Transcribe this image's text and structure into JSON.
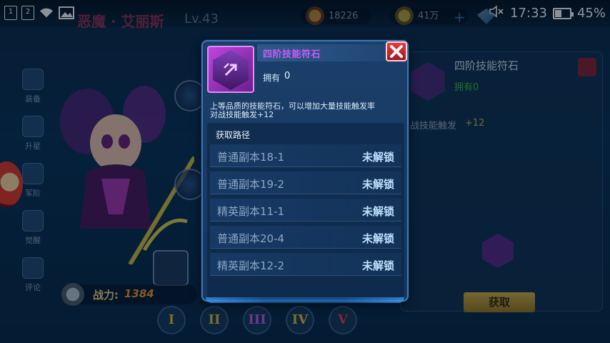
{
  "status_bar": {
    "notif_1": "1",
    "notif_2": "2",
    "time": "17:33",
    "battery": "45%",
    "battery_level": 0.45,
    "icons": [
      "sim-1-icon",
      "sim-2-icon",
      "wifi-icon",
      "image-icon",
      "mute-icon",
      "battery-icon"
    ]
  },
  "background": {
    "hero_name": "恶魔 · 艾丽斯",
    "hero_level": "Lv.43",
    "resources": {
      "potion": "18226",
      "gold": "41万"
    },
    "left_menu": [
      "装备",
      "升星",
      "军阶",
      "觉醒",
      "评论"
    ],
    "power_label": "战力:",
    "power_value": "1384",
    "tiers": [
      "I",
      "II",
      "III",
      "IV",
      "V"
    ],
    "right_panel": {
      "title": "四阶技能符石",
      "own": "拥有0",
      "stat_label": "对战技能触发",
      "stat_value": "+12",
      "get_button": "获取"
    }
  },
  "modal": {
    "title": "四阶技能符石",
    "own_label": "拥有",
    "own_value": "0",
    "description_lines": [
      "上等品质的技能符石，可以增加大量技能触发率",
      "对战技能触发+12"
    ],
    "path_header": "获取路径",
    "paths": [
      {
        "name": "普通副本18-1",
        "status": "未解锁"
      },
      {
        "name": "普通副本19-2",
        "status": "未解锁"
      },
      {
        "name": "精英副本11-1",
        "status": "未解锁"
      },
      {
        "name": "普通副本20-4",
        "status": "未解锁"
      },
      {
        "name": "精英副本12-2",
        "status": "未解锁"
      }
    ]
  },
  "colors": {
    "title_purple": "#c95cf6",
    "status_blue": "#bfe2ff",
    "close_red": "#e9383e",
    "owned_green": "#33c23a"
  }
}
